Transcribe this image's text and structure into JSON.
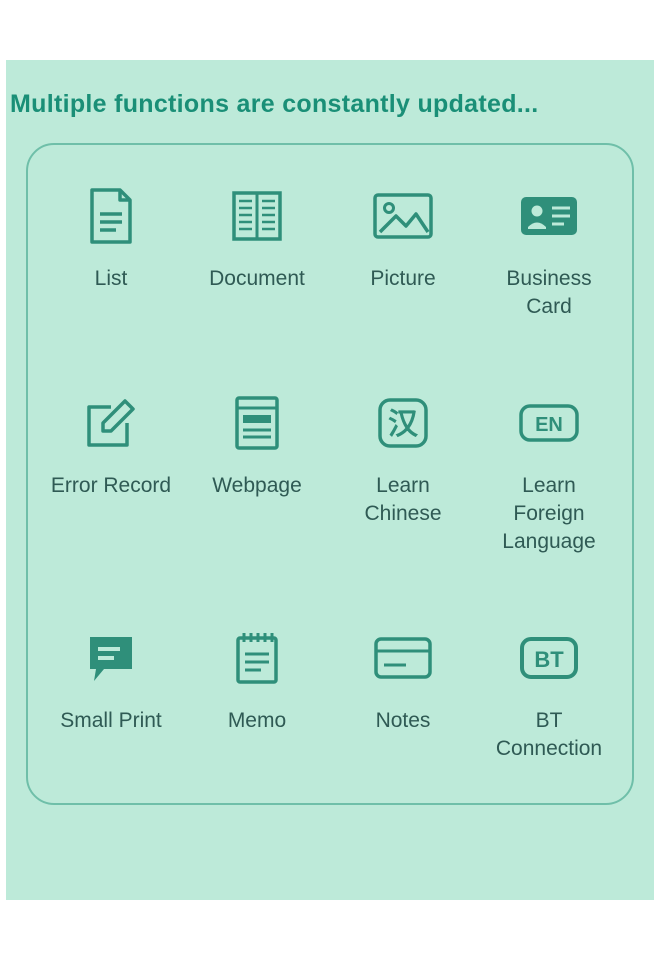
{
  "headline": "Multiple functions are constantly updated...",
  "colors": {
    "accent": "#2f8f7a",
    "panel": "#bdead9",
    "border": "#6fbfa9",
    "text": "#2f5a54"
  },
  "functions": [
    {
      "id": "list",
      "label": "List"
    },
    {
      "id": "document",
      "label": "Document"
    },
    {
      "id": "picture",
      "label": "Picture"
    },
    {
      "id": "bizcard",
      "label": "Business Card"
    },
    {
      "id": "error",
      "label": "Error Record"
    },
    {
      "id": "webpage",
      "label": "Webpage"
    },
    {
      "id": "chinese",
      "label": "Learn Chinese"
    },
    {
      "id": "foreign",
      "label": "Learn Foreign Language"
    },
    {
      "id": "smallprint",
      "label": "Small Print"
    },
    {
      "id": "memo",
      "label": "Memo"
    },
    {
      "id": "notes",
      "label": "Notes"
    },
    {
      "id": "bt",
      "label": "BT Connection"
    }
  ]
}
